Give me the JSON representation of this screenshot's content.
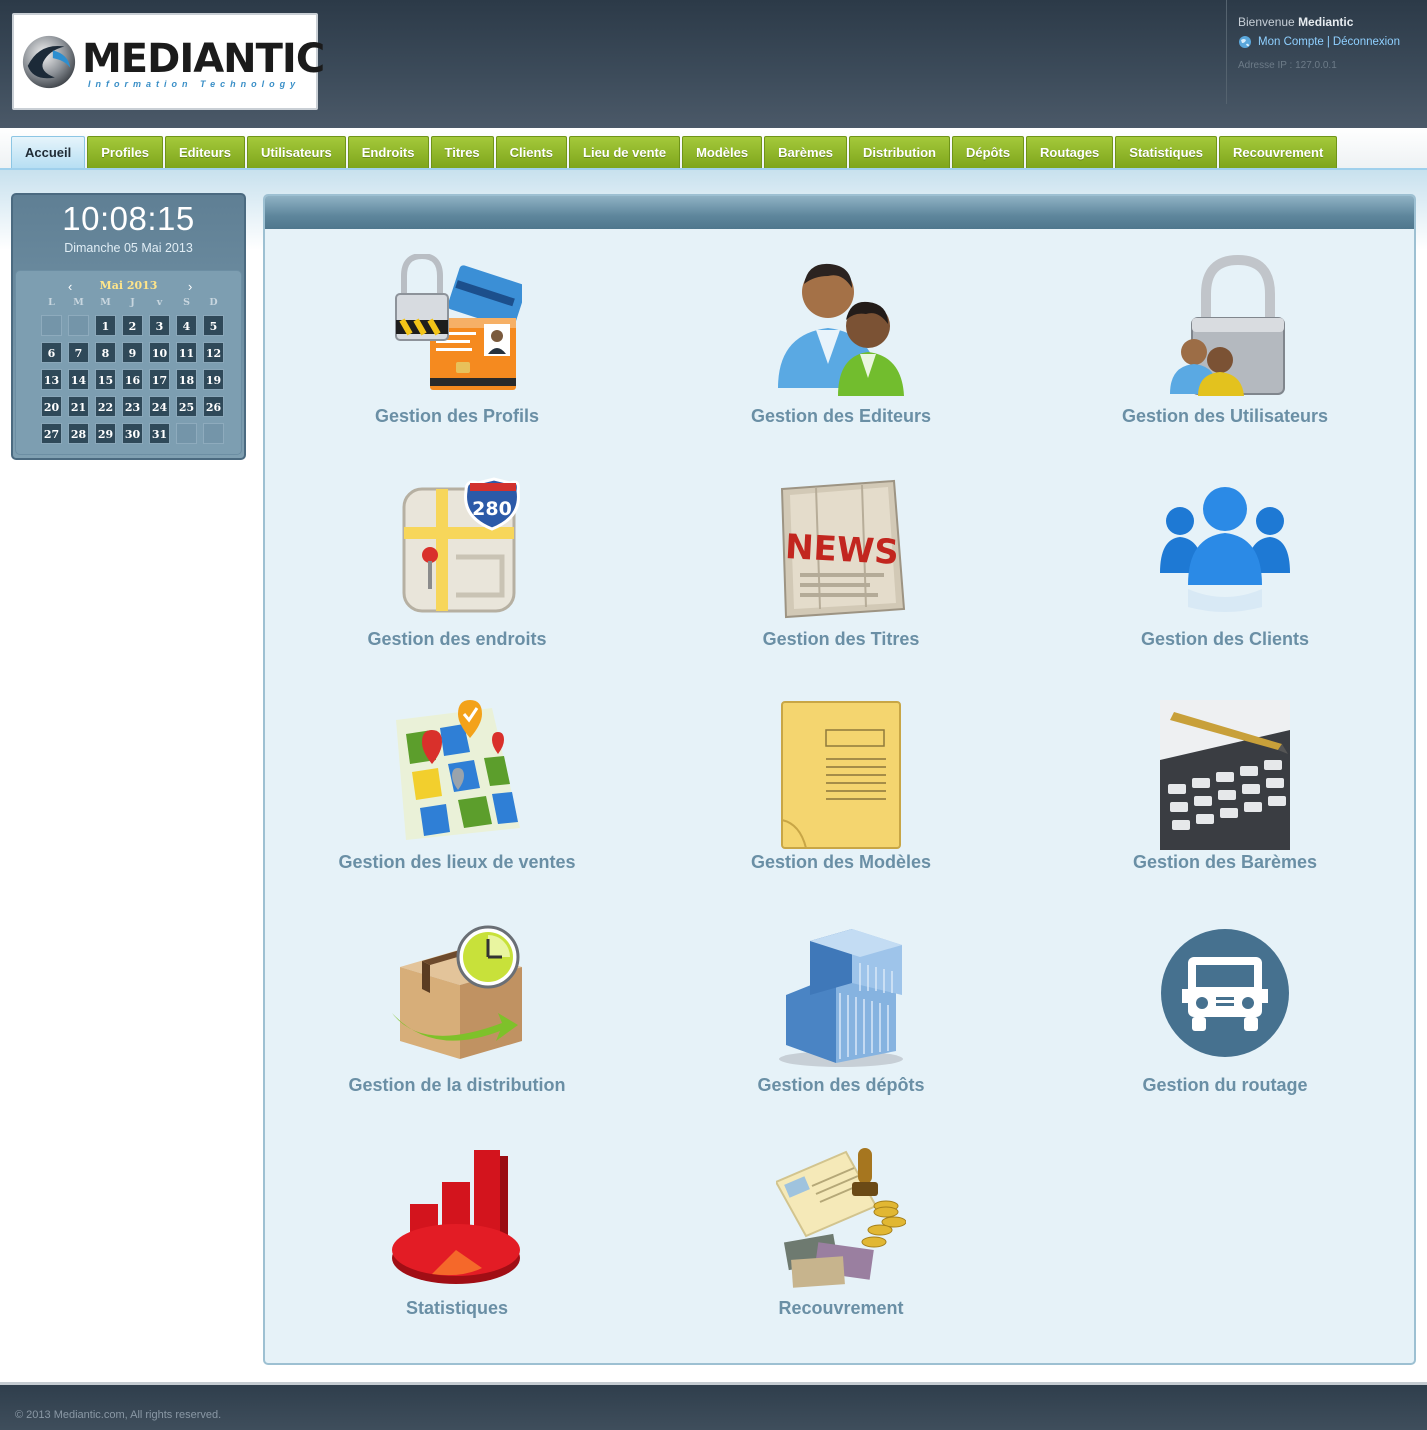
{
  "header": {
    "logo_text": "MEDIANTIC",
    "logo_subtitle": "Information Technology",
    "welcome_prefix": "Bienvenue",
    "username": "Mediantic",
    "my_account_link": "Mon Compte",
    "separator": "|",
    "logout_link": "Déconnexion",
    "ip_address": "Adresse IP : 127.0.0.1"
  },
  "nav": {
    "items": [
      {
        "label": "Accueil",
        "active": true
      },
      {
        "label": "Profiles"
      },
      {
        "label": "Editeurs"
      },
      {
        "label": "Utilisateurs"
      },
      {
        "label": "Endroits"
      },
      {
        "label": "Titres"
      },
      {
        "label": "Clients"
      },
      {
        "label": "Lieu de vente"
      },
      {
        "label": "Modèles"
      },
      {
        "label": "Barèmes"
      },
      {
        "label": "Distribution"
      },
      {
        "label": "Dépôts"
      },
      {
        "label": "Routages"
      },
      {
        "label": "Statistiques"
      },
      {
        "label": "Recouvrement"
      }
    ]
  },
  "clock": {
    "time": "10:08:15",
    "date": "Dimanche 05 Mai 2013"
  },
  "calendar": {
    "month": "Mai 2013",
    "prev": "‹",
    "next": "›",
    "weekdays": [
      "L",
      "M",
      "M",
      "J",
      "v",
      "S",
      "D"
    ],
    "leading_blanks": 2,
    "days": [
      1,
      2,
      3,
      4,
      5,
      6,
      7,
      8,
      9,
      10,
      11,
      12,
      13,
      14,
      15,
      16,
      17,
      18,
      19,
      20,
      21,
      22,
      23,
      24,
      25,
      26,
      27,
      28,
      29,
      30,
      31
    ],
    "trailing_blanks": 2
  },
  "tiles": [
    {
      "label": "Gestion des Profils",
      "icon": "id-card-lock-icon"
    },
    {
      "label": "Gestion des Editeurs",
      "icon": "two-users-icon"
    },
    {
      "label": "Gestion des Utilisateurs",
      "icon": "users-padlock-icon"
    },
    {
      "label": "Gestion des endroits",
      "icon": "road-map-280-icon"
    },
    {
      "label": "Gestion des Titres",
      "icon": "newspaper-icon"
    },
    {
      "label": "Gestion des Clients",
      "icon": "user-group-icon"
    },
    {
      "label": "Gestion des lieux de ventes",
      "icon": "map-pins-icon"
    },
    {
      "label": "Gestion des Modèles",
      "icon": "folder-icon"
    },
    {
      "label": "Gestion des Barèmes",
      "icon": "calculator-pen-icon"
    },
    {
      "label": "Gestion de la distribution",
      "icon": "box-clock-icon"
    },
    {
      "label": "Gestion des dépôts",
      "icon": "building-icon"
    },
    {
      "label": "Gestion du routage",
      "icon": "truck-icon"
    },
    {
      "label": "Statistiques",
      "icon": "chart-pie-icon"
    },
    {
      "label": "Recouvrement",
      "icon": "money-coins-icon"
    }
  ],
  "footer": {
    "copyright": "© 2013 Mediantic.com, All rights reserved."
  },
  "colors": {
    "nav_green": "#8db52a",
    "header_dark": "#3a4958",
    "tile_label": "#6a8fa5",
    "panel_bg": "#e6f2f8"
  }
}
